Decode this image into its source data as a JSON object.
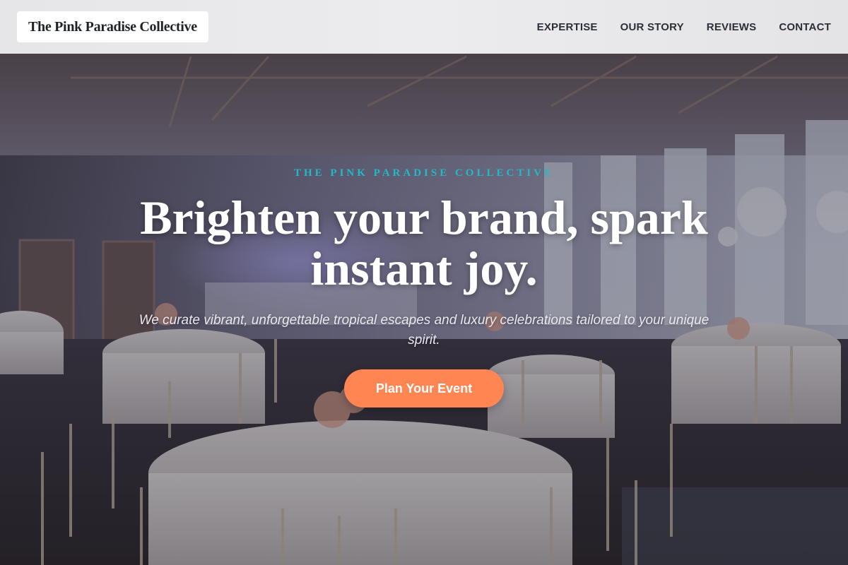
{
  "header": {
    "brand": "The Pink Paradise Collective",
    "nav": [
      {
        "label": "EXPERTISE"
      },
      {
        "label": "OUR STORY"
      },
      {
        "label": "REVIEWS"
      },
      {
        "label": "CONTACT"
      }
    ]
  },
  "hero": {
    "eyebrow": "THE PINK PARADISE COLLECTIVE",
    "headline": "Brighten your brand, spark instant joy.",
    "subheadline": "We curate vibrant, unforgettable tropical escapes and luxury celebrations tailored to your unique spirit.",
    "cta_label": "Plan Your Event"
  },
  "colors": {
    "accent_cta": "#ff8552",
    "eyebrow_teal": "#22b9c9",
    "header_bg": "#e8e8ea"
  }
}
